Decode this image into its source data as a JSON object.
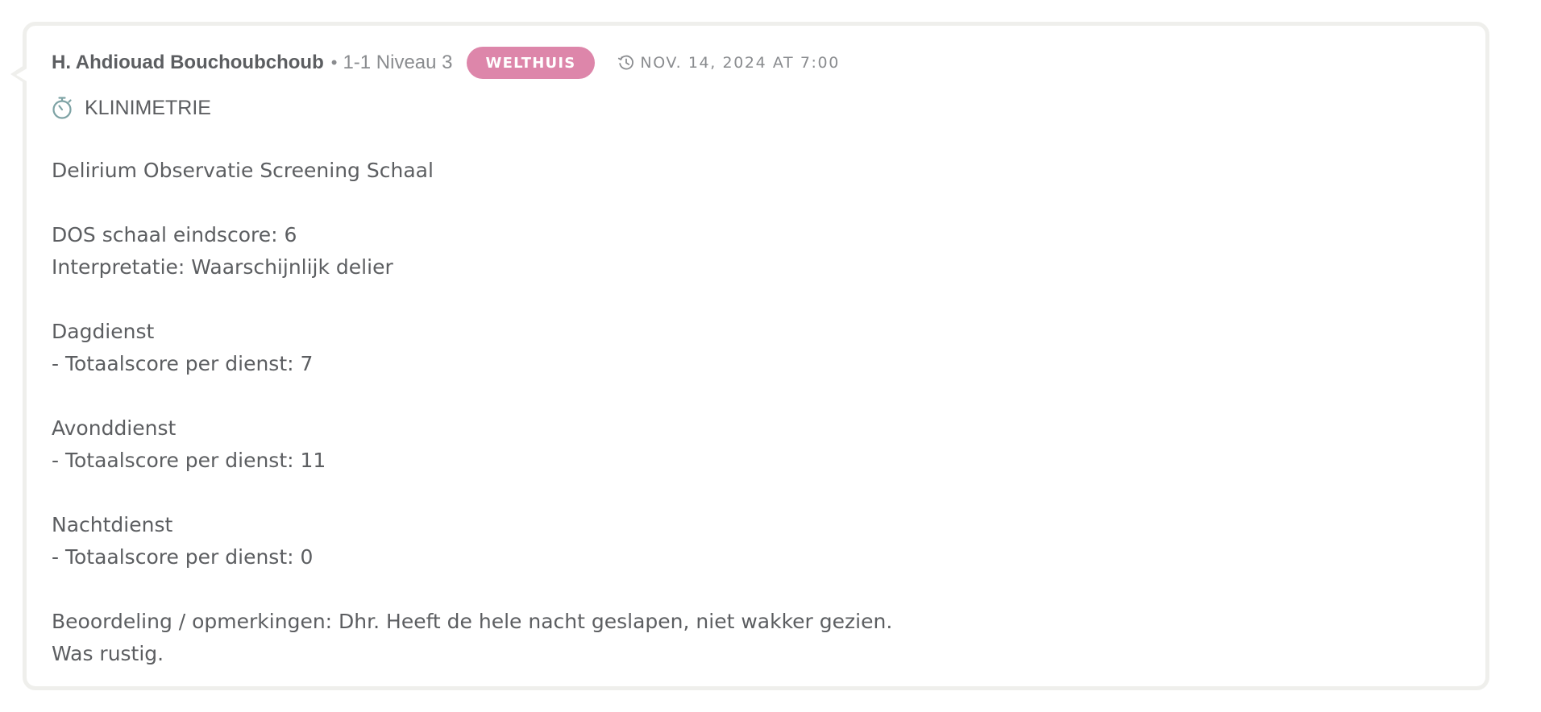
{
  "note": {
    "author": "H. Ahdiouad Bouchoubchoub",
    "separator": "•",
    "location": "1-1 Niveau 3",
    "badge": "WELTHUIS",
    "timestamp": "NOV. 14, 2024 AT 7:00",
    "category": "KLINIMETRIE",
    "body": {
      "title": "Delirium Observatie Screening Schaal",
      "score_line": "DOS schaal eindscore: 6",
      "interpretation_line": "Interpretatie: Waarschijnlijk delier",
      "shift_day": "Dagdienst",
      "shift_day_score": "- Totaalscore per dienst: 7",
      "shift_evening": "Avonddienst",
      "shift_evening_score": "- Totaalscore per dienst: 11",
      "shift_night": "Nachtdienst",
      "shift_night_score": "- Totaalscore per dienst: 0",
      "remarks_line_1": "Beoordeling / opmerkingen: Dhr. Heeft de hele nacht geslapen, niet wakker gezien.",
      "remarks_line_2": "Was rustig."
    }
  },
  "colors": {
    "text": "#5c5e61",
    "muted": "#8a8c8f",
    "badge_bg": "#dd86aa",
    "icon": "#7ea3a5",
    "card_border": "#efefec"
  },
  "icons": {
    "timestamp": "clock-history-icon",
    "category": "stopwatch-icon"
  }
}
